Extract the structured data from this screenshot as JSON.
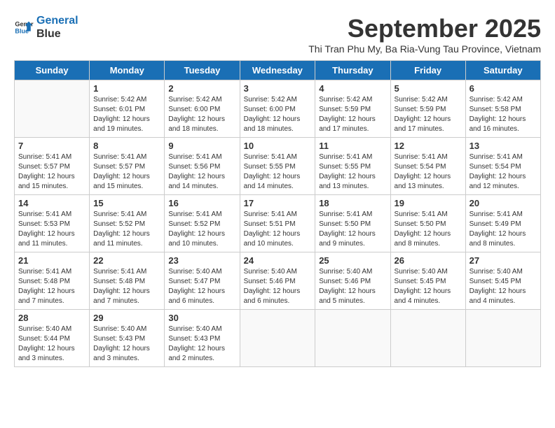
{
  "header": {
    "logo_line1": "General",
    "logo_line2": "Blue",
    "month_title": "September 2025",
    "subtitle": "Thi Tran Phu My, Ba Ria-Vung Tau Province, Vietnam"
  },
  "weekdays": [
    "Sunday",
    "Monday",
    "Tuesday",
    "Wednesday",
    "Thursday",
    "Friday",
    "Saturday"
  ],
  "weeks": [
    [
      {
        "day": "",
        "info": ""
      },
      {
        "day": "1",
        "info": "Sunrise: 5:42 AM\nSunset: 6:01 PM\nDaylight: 12 hours\nand 19 minutes."
      },
      {
        "day": "2",
        "info": "Sunrise: 5:42 AM\nSunset: 6:00 PM\nDaylight: 12 hours\nand 18 minutes."
      },
      {
        "day": "3",
        "info": "Sunrise: 5:42 AM\nSunset: 6:00 PM\nDaylight: 12 hours\nand 18 minutes."
      },
      {
        "day": "4",
        "info": "Sunrise: 5:42 AM\nSunset: 5:59 PM\nDaylight: 12 hours\nand 17 minutes."
      },
      {
        "day": "5",
        "info": "Sunrise: 5:42 AM\nSunset: 5:59 PM\nDaylight: 12 hours\nand 17 minutes."
      },
      {
        "day": "6",
        "info": "Sunrise: 5:42 AM\nSunset: 5:58 PM\nDaylight: 12 hours\nand 16 minutes."
      }
    ],
    [
      {
        "day": "7",
        "info": "Sunrise: 5:41 AM\nSunset: 5:57 PM\nDaylight: 12 hours\nand 15 minutes."
      },
      {
        "day": "8",
        "info": "Sunrise: 5:41 AM\nSunset: 5:57 PM\nDaylight: 12 hours\nand 15 minutes."
      },
      {
        "day": "9",
        "info": "Sunrise: 5:41 AM\nSunset: 5:56 PM\nDaylight: 12 hours\nand 14 minutes."
      },
      {
        "day": "10",
        "info": "Sunrise: 5:41 AM\nSunset: 5:55 PM\nDaylight: 12 hours\nand 14 minutes."
      },
      {
        "day": "11",
        "info": "Sunrise: 5:41 AM\nSunset: 5:55 PM\nDaylight: 12 hours\nand 13 minutes."
      },
      {
        "day": "12",
        "info": "Sunrise: 5:41 AM\nSunset: 5:54 PM\nDaylight: 12 hours\nand 13 minutes."
      },
      {
        "day": "13",
        "info": "Sunrise: 5:41 AM\nSunset: 5:54 PM\nDaylight: 12 hours\nand 12 minutes."
      }
    ],
    [
      {
        "day": "14",
        "info": "Sunrise: 5:41 AM\nSunset: 5:53 PM\nDaylight: 12 hours\nand 11 minutes."
      },
      {
        "day": "15",
        "info": "Sunrise: 5:41 AM\nSunset: 5:52 PM\nDaylight: 12 hours\nand 11 minutes."
      },
      {
        "day": "16",
        "info": "Sunrise: 5:41 AM\nSunset: 5:52 PM\nDaylight: 12 hours\nand 10 minutes."
      },
      {
        "day": "17",
        "info": "Sunrise: 5:41 AM\nSunset: 5:51 PM\nDaylight: 12 hours\nand 10 minutes."
      },
      {
        "day": "18",
        "info": "Sunrise: 5:41 AM\nSunset: 5:50 PM\nDaylight: 12 hours\nand 9 minutes."
      },
      {
        "day": "19",
        "info": "Sunrise: 5:41 AM\nSunset: 5:50 PM\nDaylight: 12 hours\nand 8 minutes."
      },
      {
        "day": "20",
        "info": "Sunrise: 5:41 AM\nSunset: 5:49 PM\nDaylight: 12 hours\nand 8 minutes."
      }
    ],
    [
      {
        "day": "21",
        "info": "Sunrise: 5:41 AM\nSunset: 5:48 PM\nDaylight: 12 hours\nand 7 minutes."
      },
      {
        "day": "22",
        "info": "Sunrise: 5:41 AM\nSunset: 5:48 PM\nDaylight: 12 hours\nand 7 minutes."
      },
      {
        "day": "23",
        "info": "Sunrise: 5:40 AM\nSunset: 5:47 PM\nDaylight: 12 hours\nand 6 minutes."
      },
      {
        "day": "24",
        "info": "Sunrise: 5:40 AM\nSunset: 5:46 PM\nDaylight: 12 hours\nand 6 minutes."
      },
      {
        "day": "25",
        "info": "Sunrise: 5:40 AM\nSunset: 5:46 PM\nDaylight: 12 hours\nand 5 minutes."
      },
      {
        "day": "26",
        "info": "Sunrise: 5:40 AM\nSunset: 5:45 PM\nDaylight: 12 hours\nand 4 minutes."
      },
      {
        "day": "27",
        "info": "Sunrise: 5:40 AM\nSunset: 5:45 PM\nDaylight: 12 hours\nand 4 minutes."
      }
    ],
    [
      {
        "day": "28",
        "info": "Sunrise: 5:40 AM\nSunset: 5:44 PM\nDaylight: 12 hours\nand 3 minutes."
      },
      {
        "day": "29",
        "info": "Sunrise: 5:40 AM\nSunset: 5:43 PM\nDaylight: 12 hours\nand 3 minutes."
      },
      {
        "day": "30",
        "info": "Sunrise: 5:40 AM\nSunset: 5:43 PM\nDaylight: 12 hours\nand 2 minutes."
      },
      {
        "day": "",
        "info": ""
      },
      {
        "day": "",
        "info": ""
      },
      {
        "day": "",
        "info": ""
      },
      {
        "day": "",
        "info": ""
      }
    ]
  ]
}
